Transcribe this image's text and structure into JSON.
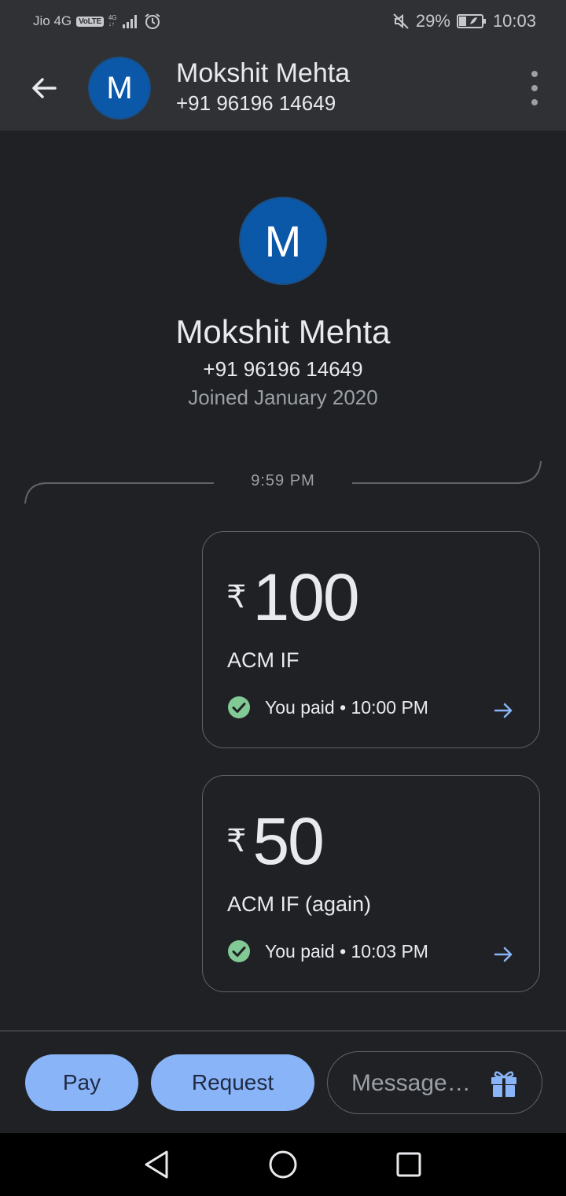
{
  "status_bar": {
    "carrier": "Jio 4G",
    "volte": "VoLTE",
    "network_type": "4G",
    "battery": "29%",
    "time": "10:03"
  },
  "app_bar": {
    "avatar_initial": "M",
    "contact_name": "Mokshit Mehta",
    "contact_phone": "+91 96196 14649"
  },
  "profile": {
    "avatar_initial": "M",
    "name": "Mokshit Mehta",
    "phone": "+91 96196 14649",
    "joined": "Joined January 2020"
  },
  "conversation": {
    "timestamp": "9:59 PM",
    "payments": [
      {
        "currency": "₹",
        "amount": "100",
        "note": "ACM IF",
        "status": "You paid • 10:00 PM"
      },
      {
        "currency": "₹",
        "amount": "50",
        "note": "ACM IF (again)",
        "status": "You paid • 10:03 PM"
      }
    ]
  },
  "bottom_bar": {
    "pay_label": "Pay",
    "request_label": "Request",
    "message_placeholder": "Message…"
  },
  "colors": {
    "background": "#202124",
    "app_bar": "#303134",
    "accent": "#8ab4f8",
    "avatar": "#0b57a8",
    "success": "#81c995"
  }
}
